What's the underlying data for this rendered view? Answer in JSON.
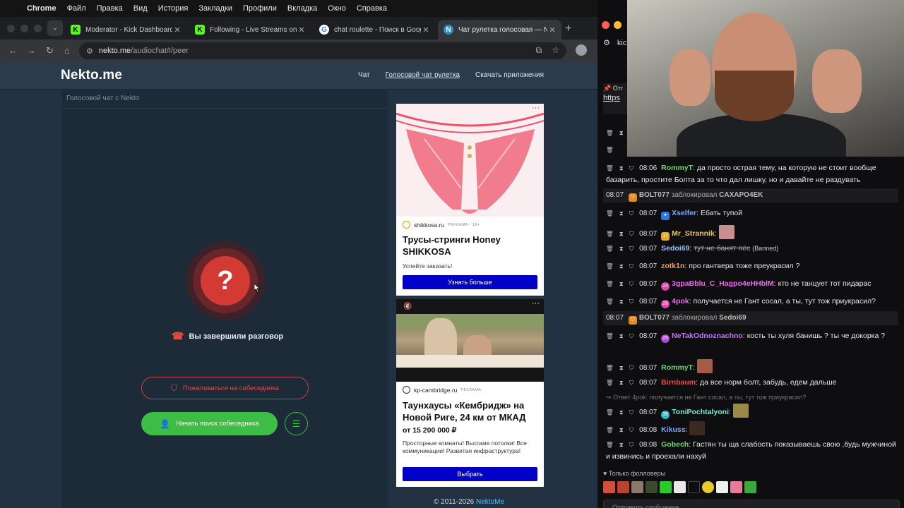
{
  "menubar": {
    "items": [
      "Chrome",
      "Файл",
      "Правка",
      "Вид",
      "История",
      "Закладки",
      "Профили",
      "Вкладка",
      "Окно",
      "Справка"
    ]
  },
  "tabs": [
    {
      "title": "Moderator - Kick Dashboard",
      "favicon": "kick-icon"
    },
    {
      "title": "Following - Live Streams on K",
      "favicon": "kick-icon"
    },
    {
      "title": "chat roulette - Поиск в Goog",
      "favicon": "google-icon"
    },
    {
      "title": "Чат рулетка голосовая — Ne",
      "favicon": "nekto-icon",
      "active": true
    }
  ],
  "omnibox": {
    "host": "nekto.me",
    "path": "/audiochat#/peer"
  },
  "site": {
    "logo": "Nekto.me",
    "nav": [
      "Чат",
      "Голосовой чат рулетка",
      "Скачать приложения"
    ],
    "nav_active_index": 1,
    "chat_title": "Голосовой чат с Nekto",
    "status_symbol": "?",
    "ended_text": "Вы завершили разговор",
    "report_button": "Пожаловаться на собеседника",
    "search_button": "Начать поиск собеседника",
    "footer_text": "© 2011-2026",
    "footer_link": "NektoMe"
  },
  "ads": [
    {
      "source": "shikkosa.ru",
      "label": "РЕКЛАМА · 18+",
      "headline": "Трусы-стринги Honey SHIKKOSA",
      "subtitle": "Успейте заказать!",
      "cta": "Узнать больше"
    },
    {
      "source": "kp-cambridge.ru",
      "label": "РЕКЛАМА",
      "headline": "Таунхаусы «Кембридж» на Новой Риге, 24 км от МКАД",
      "price": "от 15 200 000 ₽",
      "desc": "Просторные комнаты! Высокие потолки! Все коммуникации! Развитая инфраструктура!",
      "cta": "Выбрать"
    }
  ],
  "kick": {
    "tab_label": "kick",
    "pinned_text": "Отг",
    "pinned_link": "https",
    "messages": [
      {
        "time": "08:06",
        "user": "RommyT",
        "color": "#6ed66e",
        "text": "да просто острая тему, на которую не стоит вообще базарить, простите Болта за то что дал лишку, но и давайте не раздувать"
      },
      {
        "time": "08:07",
        "user": "Xselfer",
        "color": "#7aa7ff",
        "text": "Ебать тупой"
      },
      {
        "time": "08:07",
        "user": "Mr_Strannik",
        "color": "#e8c65a",
        "badge": "17",
        "text": ""
      },
      {
        "time": "08:07",
        "user": "Sedoi69",
        "color": "#9cc2ff",
        "text": "тут не банят пёс",
        "deleted": true,
        "note": "(Banned)"
      },
      {
        "time": "08:07",
        "user": "zotk1n",
        "color": "#ff9a5a",
        "text": "про гантвера тоже преукрасил ?"
      },
      {
        "time": "08:07",
        "user": "3gpaBblu_C_Hagpo4eHHblM",
        "color": "#e86ee8",
        "badge": "24",
        "text": "кто не танцует тот пидарас"
      },
      {
        "time": "08:07",
        "user": "4pok",
        "color": "#e86ee8",
        "badge": "26",
        "text": "получается не Гант сосал, а ты, тут тож приукрасил?"
      },
      {
        "time": "08:07",
        "user": "NeTakOdnoznachno",
        "color": "#c17ae8",
        "badge": "25",
        "text": "кость ты хуля банишь ? ты че докорка ?"
      },
      {
        "time": "08:07",
        "user": "RommyT",
        "color": "#6ed66e",
        "text": ""
      },
      {
        "time": "08:07",
        "user": "Birnbaum",
        "color": "#e84a4a",
        "text": "да все норм болт, забудь, едем дальше"
      },
      {
        "time": "08:07",
        "user": "ToniPochtalyoni",
        "color": "#7ae8d6",
        "badge": "36",
        "text": ""
      },
      {
        "time": "08:08",
        "user": "Kikuss",
        "color": "#7aa7ff",
        "text": ""
      },
      {
        "time": "08:08",
        "user": "Gobech",
        "color": "#6ed66e",
        "text": "Гастян ты ща слабость показываешь свою ,будь мужчиной и извинись и проехали нахуй"
      }
    ],
    "system": [
      {
        "time": "08:07",
        "mod": "BOLT077",
        "action": "заблокировал",
        "target": "CAXAPO4EK"
      },
      {
        "time": "08:07",
        "mod": "BOLT077",
        "action": "заблокировал",
        "target": "Sedoi69"
      }
    ],
    "reply_text": "Ответ 4pok: получается не Гант сосал, а ты, тут тож приукрасил?",
    "followers_only": "Только фолловеры",
    "input_placeholder": "Отправить сообщение"
  },
  "colors": {
    "accent_green": "#3dbd45",
    "danger_red": "#d33a33",
    "ad_button_blue": "#0000c8",
    "nekto_link": "#4cc2ff"
  }
}
